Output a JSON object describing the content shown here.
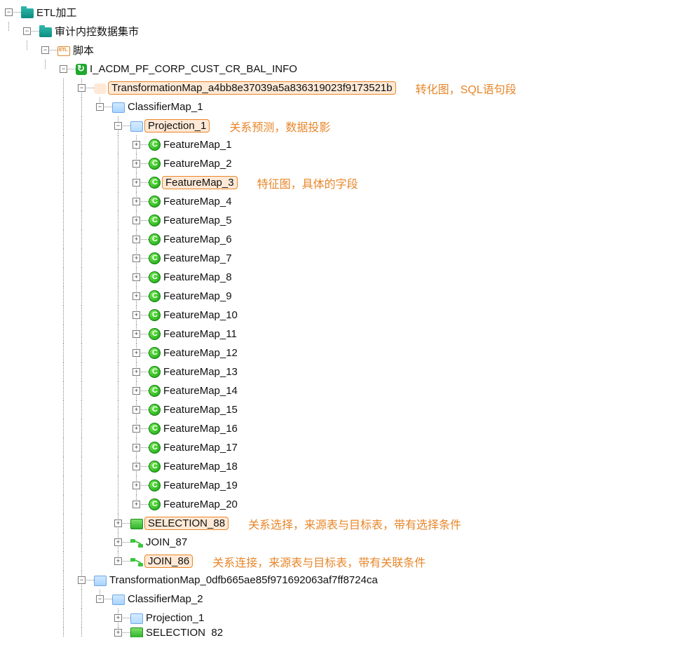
{
  "tree": {
    "root": "ETL加工",
    "l1": "审计内控数据集市",
    "l2": "脚本",
    "l3": "I_ACDM_PF_CORP_CUST_CR_BAL_INFO",
    "tmap1": "TransformationMap_a4bb8e37039a5a836319023f9173521b",
    "cmap1": "ClassifierMap_1",
    "proj1": "Projection_1",
    "features": [
      "FeatureMap_1",
      "FeatureMap_2",
      "FeatureMap_3",
      "FeatureMap_4",
      "FeatureMap_5",
      "FeatureMap_6",
      "FeatureMap_7",
      "FeatureMap_8",
      "FeatureMap_9",
      "FeatureMap_10",
      "FeatureMap_11",
      "FeatureMap_12",
      "FeatureMap_13",
      "FeatureMap_14",
      "FeatureMap_15",
      "FeatureMap_16",
      "FeatureMap_17",
      "FeatureMap_18",
      "FeatureMap_19",
      "FeatureMap_20"
    ],
    "sel88": "SELECTION_88",
    "join87": "JOIN_87",
    "join86": "JOIN_86",
    "tmap2": "TransformationMap_0dfb665ae85f971692063af7ff8724ca",
    "cmap2": "ClassifierMap_2",
    "proj2": "Projection_1",
    "sel82": "SELECTION_82"
  },
  "annotations": {
    "tmap": "转化图，SQL语句段",
    "proj": "关系预测，数据投影",
    "feat": "特征图，具体的字段",
    "sel": "关系选择，来源表与目标表，带有选择条件",
    "join": "关系连接，来源表与目标表，带有关联条件"
  }
}
